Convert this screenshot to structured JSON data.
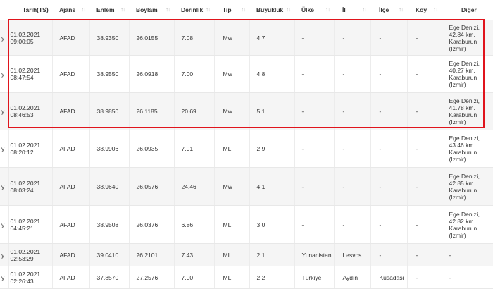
{
  "columns": [
    {
      "key": "first",
      "label": ""
    },
    {
      "key": "tarih",
      "label": "Tarih(TS)"
    },
    {
      "key": "ajans",
      "label": "Ajans"
    },
    {
      "key": "enlem",
      "label": "Enlem"
    },
    {
      "key": "boylam",
      "label": "Boylam"
    },
    {
      "key": "derinlik",
      "label": "Derinlik"
    },
    {
      "key": "tip",
      "label": "Tip"
    },
    {
      "key": "buyukluk",
      "label": "Büyüklük"
    },
    {
      "key": "ulke",
      "label": "Ülke"
    },
    {
      "key": "il",
      "label": "İl"
    },
    {
      "key": "ilce",
      "label": "İlçe"
    },
    {
      "key": "koy",
      "label": "Köy"
    },
    {
      "key": "diger",
      "label": "Diğer"
    }
  ],
  "rows": [
    {
      "first": "y",
      "tarih_date": "01.02.2021",
      "tarih_time": "09:00:05",
      "ajans": "AFAD",
      "enlem": "38.9350",
      "boylam": "26.0155",
      "derinlik": "7.08",
      "tip": "Mw",
      "buyukluk": "4.7",
      "ulke": "-",
      "il": "-",
      "ilce": "-",
      "koy": "-",
      "diger_1": "Ege Denizi,",
      "diger_2": "42.84 km.",
      "diger_3": "Karaburun",
      "diger_4": "(Izmir)"
    },
    {
      "first": "y",
      "tarih_date": "01.02.2021",
      "tarih_time": "08:47:54",
      "ajans": "AFAD",
      "enlem": "38.9550",
      "boylam": "26.0918",
      "derinlik": "7.00",
      "tip": "Mw",
      "buyukluk": "4.8",
      "ulke": "-",
      "il": "-",
      "ilce": "-",
      "koy": "-",
      "diger_1": "Ege Denizi,",
      "diger_2": "40.27 km.",
      "diger_3": "Karaburun",
      "diger_4": "(Izmir)"
    },
    {
      "first": "y",
      "tarih_date": "01.02.2021",
      "tarih_time": "08:46:53",
      "ajans": "AFAD",
      "enlem": "38.9850",
      "boylam": "26.1185",
      "derinlik": "20.69",
      "tip": "Mw",
      "buyukluk": "5.1",
      "ulke": "-",
      "il": "-",
      "ilce": "-",
      "koy": "-",
      "diger_1": "Ege Denizi,",
      "diger_2": "41.78 km.",
      "diger_3": "Karaburun",
      "diger_4": "(Izmir)"
    },
    {
      "first": "y",
      "tarih_date": "01.02.2021",
      "tarih_time": "08:20:12",
      "ajans": "AFAD",
      "enlem": "38.9906",
      "boylam": "26.0935",
      "derinlik": "7.01",
      "tip": "ML",
      "buyukluk": "2.9",
      "ulke": "-",
      "il": "-",
      "ilce": "-",
      "koy": "-",
      "diger_1": "Ege Denizi,",
      "diger_2": "43.46 km.",
      "diger_3": "Karaburun",
      "diger_4": "(Izmir)"
    },
    {
      "first": "y",
      "tarih_date": "01.02.2021",
      "tarih_time": "08:03:24",
      "ajans": "AFAD",
      "enlem": "38.9640",
      "boylam": "26.0576",
      "derinlik": "24.46",
      "tip": "Mw",
      "buyukluk": "4.1",
      "ulke": "-",
      "il": "-",
      "ilce": "-",
      "koy": "-",
      "diger_1": "Ege Denizi,",
      "diger_2": "42.85 km.",
      "diger_3": "Karaburun",
      "diger_4": "(Izmir)"
    },
    {
      "first": "y",
      "tarih_date": "01.02.2021",
      "tarih_time": "04:45:21",
      "ajans": "AFAD",
      "enlem": "38.9508",
      "boylam": "26.0376",
      "derinlik": "6.86",
      "tip": "ML",
      "buyukluk": "3.0",
      "ulke": "-",
      "il": "-",
      "ilce": "-",
      "koy": "-",
      "diger_1": "Ege Denizi,",
      "diger_2": "42.82 km.",
      "diger_3": "Karaburun",
      "diger_4": "(Izmir)"
    },
    {
      "first": "y",
      "tarih_date": "01.02.2021",
      "tarih_time": "02:53:29",
      "ajans": "AFAD",
      "enlem": "39.0410",
      "boylam": "26.2101",
      "derinlik": "7.43",
      "tip": "ML",
      "buyukluk": "2.1",
      "ulke": "Yunanistan",
      "il": "Lesvos",
      "ilce": "-",
      "koy": "-",
      "diger_1": "-",
      "diger_2": "",
      "diger_3": "",
      "diger_4": ""
    },
    {
      "first": "y",
      "tarih_date": "01.02.2021",
      "tarih_time": "02:26:43",
      "ajans": "AFAD",
      "enlem": "37.8570",
      "boylam": "27.2576",
      "derinlik": "7.00",
      "tip": "ML",
      "buyukluk": "2.2",
      "ulke": "Türkiye",
      "il": "Aydın",
      "ilce": "Kusadasi",
      "koy": "-",
      "diger_1": "-",
      "diger_2": "",
      "diger_3": "",
      "diger_4": ""
    }
  ],
  "icons": {
    "sort": "sort-arrows-icon",
    "sort_active": "sort-desc-icon"
  },
  "colors": {
    "highlight": "#e0141c",
    "row_alt": "#f5f5f5"
  }
}
